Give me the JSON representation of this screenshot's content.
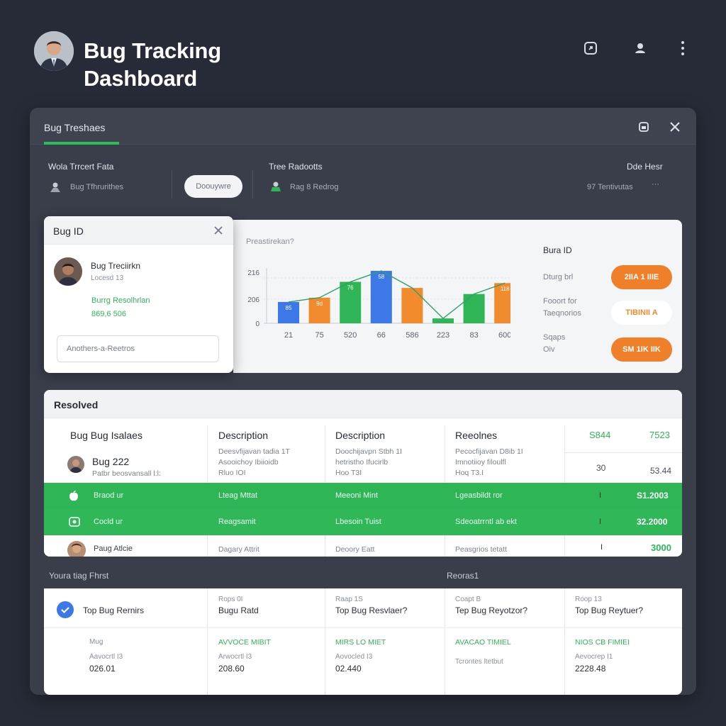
{
  "header": {
    "title_line1": "Bug Tracking",
    "title_line2": "Dashboard",
    "icons": [
      "external-link-icon",
      "user-icon",
      "more-vertical-icon"
    ]
  },
  "panel": {
    "title": "Bug Treshaes",
    "filters": {
      "group1_label": "Wola Trrcert Fata",
      "group1_value": "Bug Tfhrurithes",
      "button_label": "Doouywre",
      "group2_label": "Tree Radootts",
      "group2_value": "Rag 8 Redrog",
      "group3_label": "Dde Hesr",
      "group3_value": "97 Tentivutas",
      "group3_more": "···"
    }
  },
  "bug_card": {
    "title": "Bug ID",
    "name": "Bug Treciirkn",
    "sub": "Locesd 13",
    "resolution_label": "Burrg Resolhrlan",
    "resolution_value": "869,6 506",
    "input_placeholder": "Anothers-a-Reetros"
  },
  "chart_card": {
    "caption": "Preastirekan?",
    "side": {
      "title": "Bura ID",
      "row1_label": "Dturg brl",
      "row1_badge": "2IIA 1 IIIE",
      "row2_label1": "Fooort for",
      "row2_label2": "Taeqnorios",
      "row2_badge": "TIBINII A",
      "row3_label1": "Sqaps",
      "row3_label2": "Oiv",
      "row3_badge": "SM 1IK IIK"
    }
  },
  "chart_data": {
    "type": "bar",
    "categories": [
      "21",
      "75",
      "520",
      "66",
      "586",
      "223",
      "83",
      "600"
    ],
    "ytick_labels": [
      "0",
      "206",
      "216"
    ],
    "values": [
      35,
      42,
      68,
      86,
      58,
      8,
      48,
      66
    ],
    "bar_labels": [
      "85",
      "9d",
      "76",
      "58",
      "",
      "",
      "",
      "118"
    ],
    "colors": [
      "#3d78e8",
      "#f28a2e",
      "#2fb556",
      "#3d78e8",
      "#f28a2e",
      "#2fb556",
      "#2fb556",
      "#f28a2e"
    ],
    "trend_line": true,
    "ylim": [
      0,
      100
    ]
  },
  "table": {
    "title": "Resolved",
    "headers": [
      "Bug Bug Isalaes",
      "Description",
      "Description",
      "Reeolnes",
      "S844",
      "7523"
    ],
    "row1": {
      "name": "Bug 222",
      "sub": "Patbr beosvansall l:l:",
      "desc1": [
        "Deesvfijavan tadia 1T",
        "Asooichoy Ibiioidb",
        "Rluo IOI"
      ],
      "desc2": [
        "Doochijavpn Stbh 1I",
        "hetristho Ifucirlb",
        "Hoo T3I"
      ],
      "desc3": [
        "Pecocfijavan D8ib 1I",
        "Imnotiioy filoulfl",
        "Hoq T3.I"
      ],
      "v1": "30",
      "v2": "53.44"
    },
    "row2": {
      "name": "Braod ur",
      "c1": "Lteag Mttat",
      "c2": "Meeoni Mint",
      "c3": "Lgeasbildt ror",
      "v1": "I",
      "v2": "S1.2003"
    },
    "row3": {
      "name": "Cocld ur",
      "c1": "Reagsamit",
      "c2": "Lbesoin Tuist",
      "c3": "Sdeoatrrntl ab ekt",
      "v1": "I",
      "v2": "32.2000"
    },
    "row4": {
      "name": "Paug Atlcie",
      "c1": "Dagary Attrit",
      "c2": "Deoory Eatt",
      "c3": "Peasgrios tetatt",
      "v1": "I",
      "v2": "3000"
    }
  },
  "bottom": {
    "left_label": "Youra tiag Fhrst",
    "right_label": "Reoras1",
    "col0": {
      "title": "Top Bug Rernirs",
      "l1": "Mug",
      "l2": "Aavocrtl I3",
      "val": "026.01"
    },
    "col1": {
      "sub": "Rops 0I",
      "title": "Bugu Ratd",
      "green": "AVVOCE MIBIT",
      "l2": "Arwocrtl I3",
      "val": "208.60"
    },
    "col2": {
      "sub": "Raap 1S",
      "title": "Top Bug Resvlaer?",
      "green": "MIRS LO MIET",
      "l2": "Aovocled I3",
      "val": "02.440"
    },
    "col3": {
      "sub": "Coapt B",
      "title": "Tep Bug Reyotzor?",
      "green": "AVACAO TIMIEL",
      "l2": "Tcrontes ltetbut",
      "val": ""
    },
    "col4": {
      "sub": "Roop 13",
      "title": "Top Bug Reytuer?",
      "green": "NIOS CB FIMIEI",
      "l2": "Aevocrep I1",
      "val": "2228.48"
    }
  }
}
